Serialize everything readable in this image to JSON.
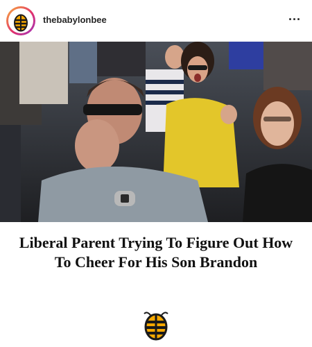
{
  "post": {
    "username": "thebabylonbee",
    "more_icon": "more-options-icon",
    "avatar_icon": "babylon-bee-logo"
  },
  "article": {
    "headline": "Liberal Parent Trying To Figure Out How To Cheer For His Son Brandon"
  },
  "colors": {
    "bee_yellow": "#f6a800",
    "bee_dark": "#1a1a1a"
  }
}
